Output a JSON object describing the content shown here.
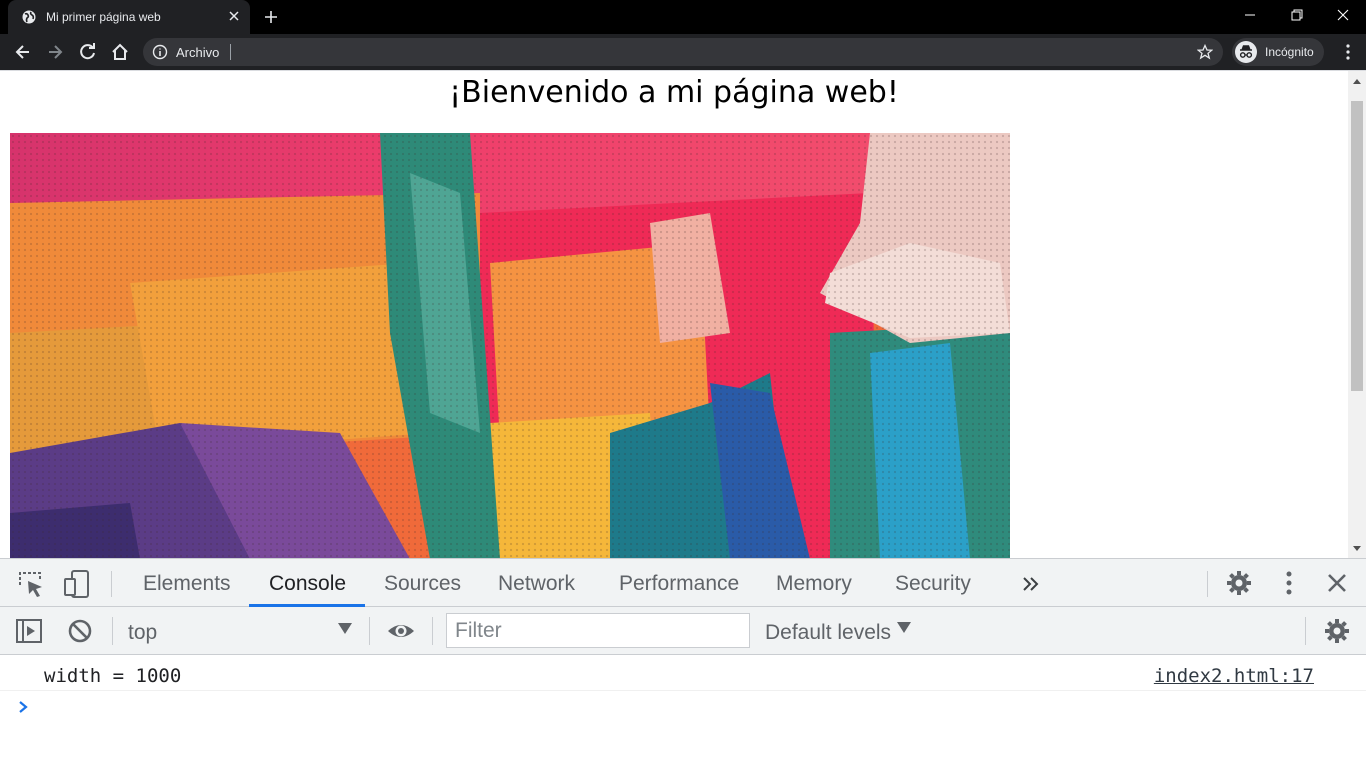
{
  "browser": {
    "tab_title": "Mi primer página web",
    "address_text": "Archivo",
    "profile_label": "Incógnito"
  },
  "page": {
    "heading": "¡Bienvenido a mi página web!"
  },
  "devtools": {
    "tabs": [
      "Elements",
      "Console",
      "Sources",
      "Network",
      "Performance",
      "Memory",
      "Security"
    ],
    "active_tab": "Console",
    "context": "top",
    "filter_placeholder": "Filter",
    "levels": "Default levels",
    "console_message": {
      "text": "width = 1000",
      "source": "index2.html:17"
    }
  },
  "colors": {
    "accent": "#1a73e8",
    "chrome_dark": "#202124"
  }
}
